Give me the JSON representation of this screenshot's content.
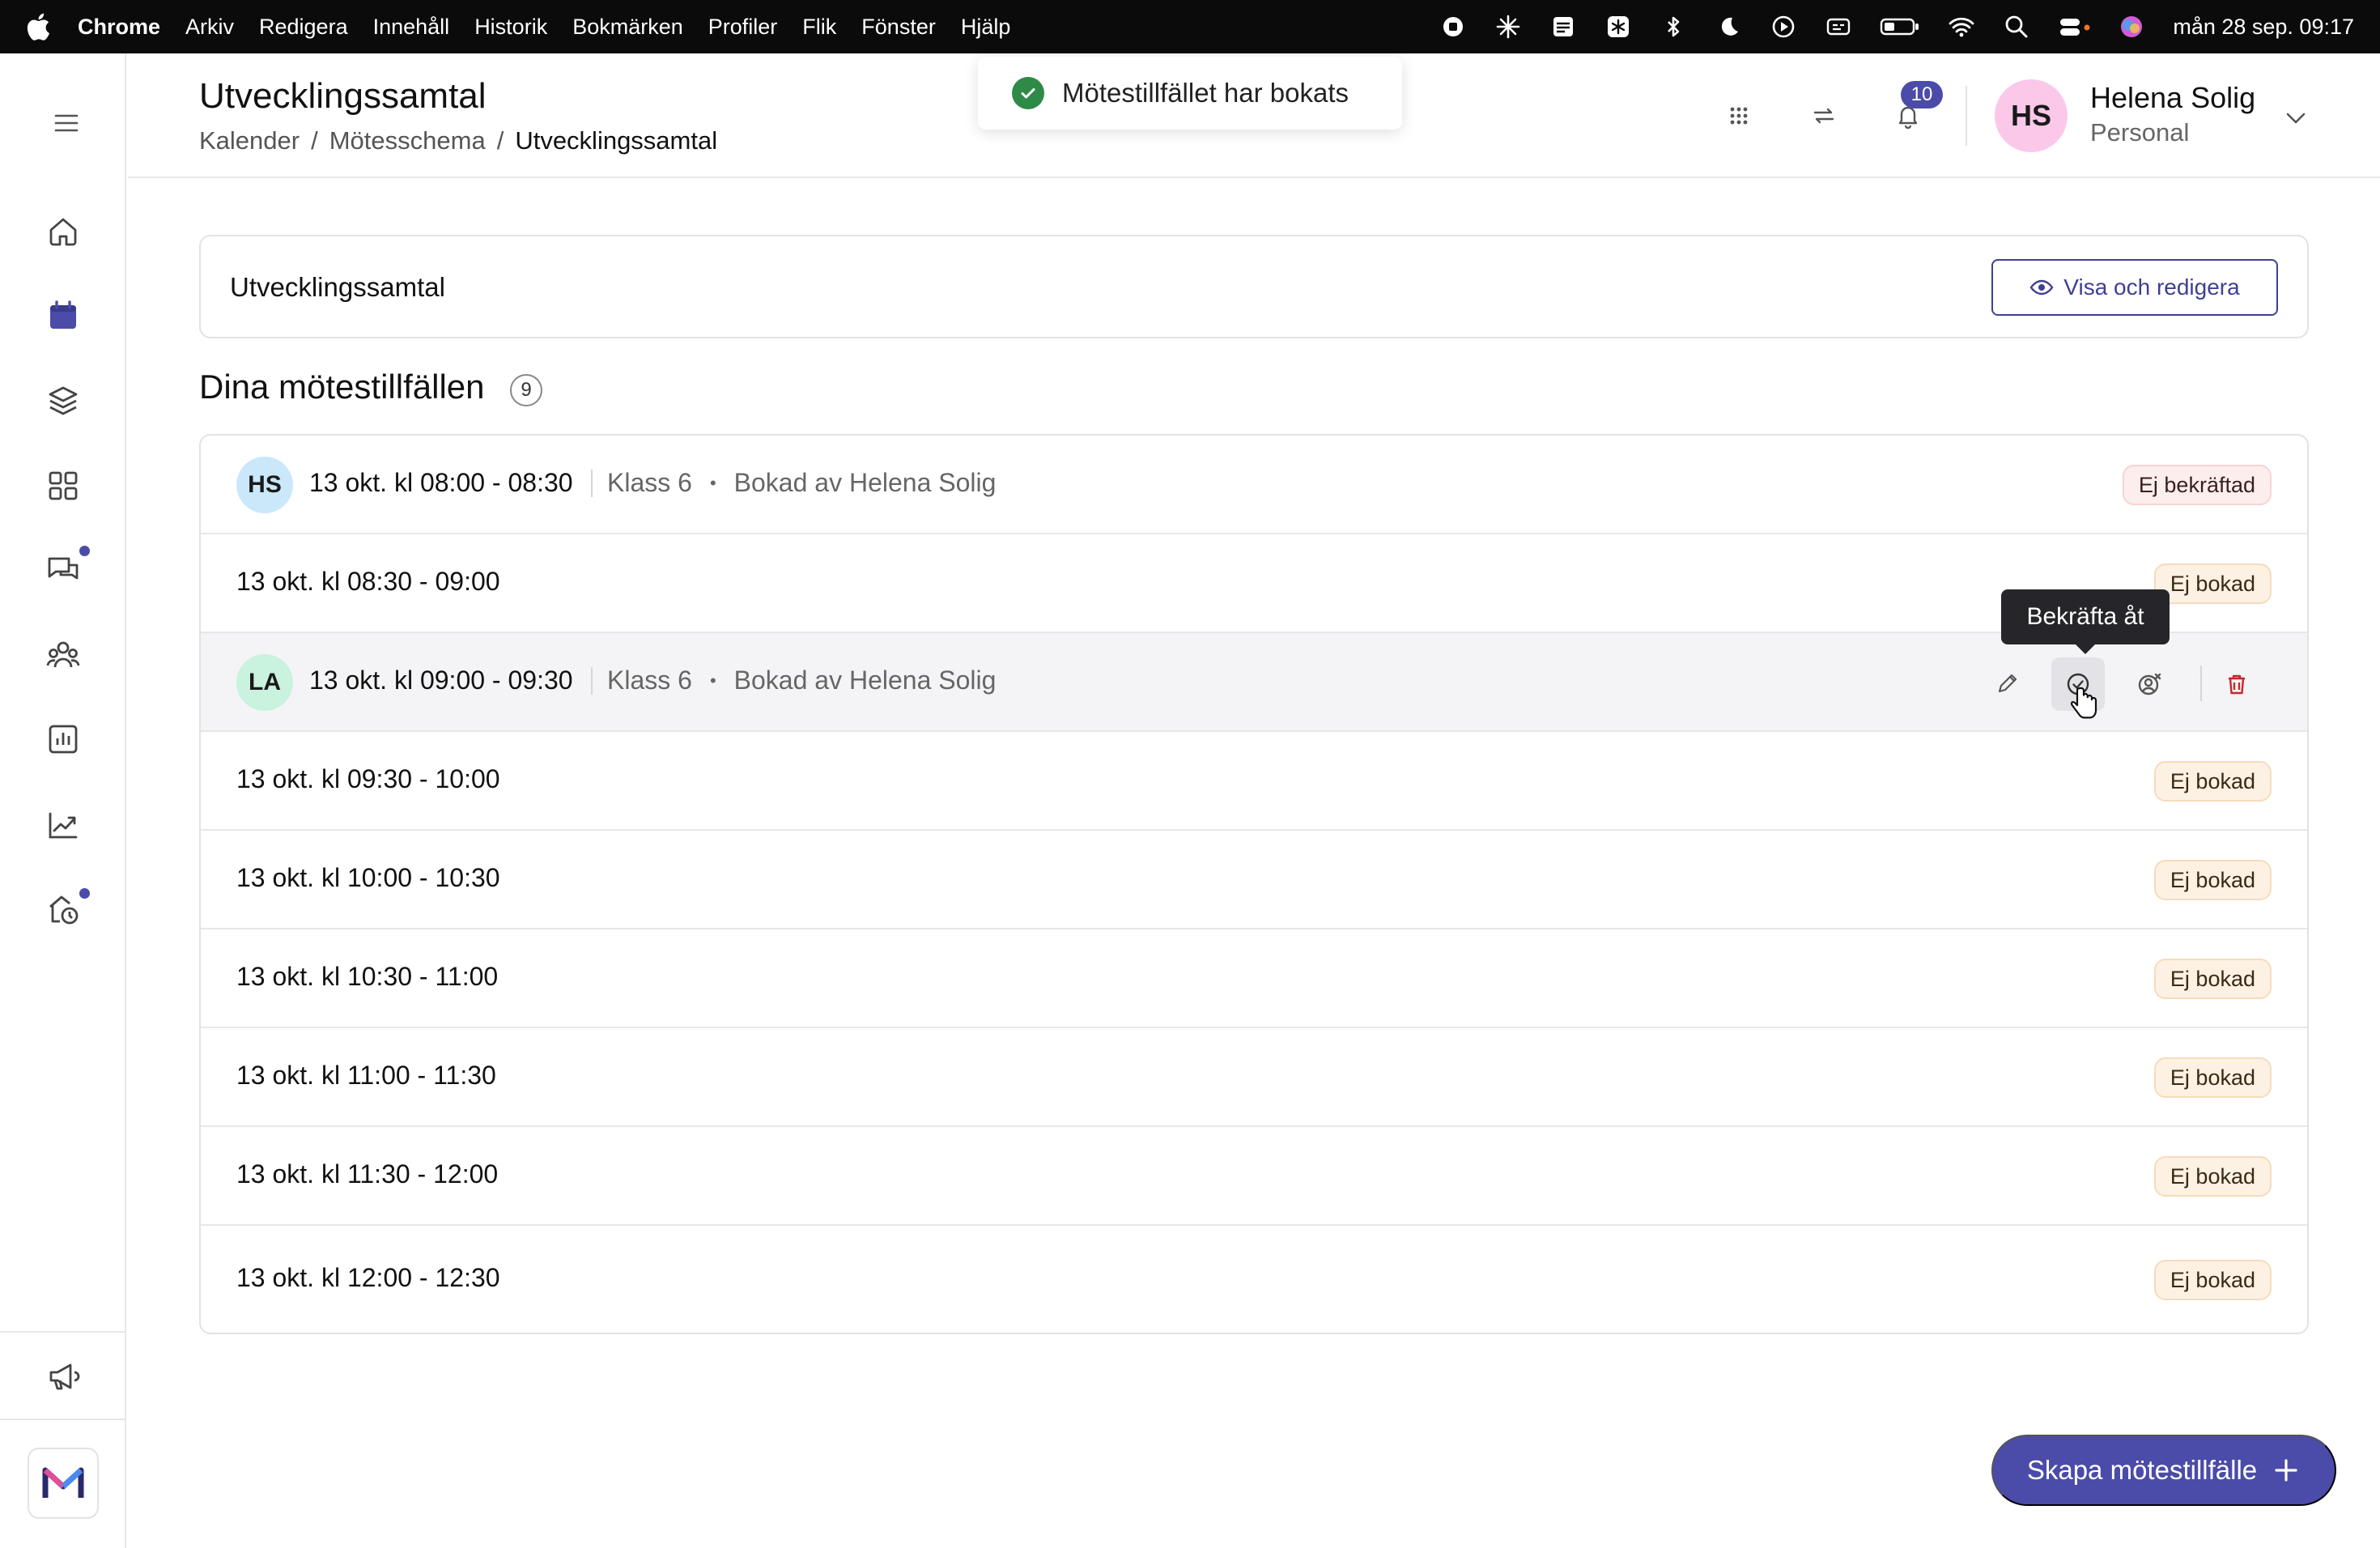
{
  "menubar": {
    "app_name": "Chrome",
    "menus": [
      "Arkiv",
      "Redigera",
      "Innehåll",
      "Historik",
      "Bokmärken",
      "Profiler",
      "Flik",
      "Fönster",
      "Hjälp"
    ],
    "clock": "mån 28 sep. 09:17"
  },
  "sidebar": {
    "items": [
      {
        "name": "home",
        "icon": "home-icon"
      },
      {
        "name": "calendar",
        "icon": "calendar-icon",
        "active": true
      },
      {
        "name": "layers",
        "icon": "layers-icon"
      },
      {
        "name": "apps",
        "icon": "grid-icon"
      },
      {
        "name": "messages",
        "icon": "chat-icon",
        "dot": true
      },
      {
        "name": "groups",
        "icon": "people-icon"
      },
      {
        "name": "reports",
        "icon": "bar-chart-icon"
      },
      {
        "name": "analytics",
        "icon": "trend-chart-icon"
      },
      {
        "name": "school",
        "icon": "house-clock-icon",
        "dot": true
      }
    ],
    "announcement_icon": "megaphone-icon",
    "logo": "m-logo"
  },
  "header": {
    "title": "Utvecklingssamtal",
    "breadcrumb": [
      "Kalender",
      "/",
      "Mötesschema",
      "/",
      "Utvecklingssamtal"
    ],
    "notifications_count": "10",
    "user": {
      "initials": "HS",
      "name": "Helena Solig",
      "role": "Personal"
    }
  },
  "toast": {
    "text": "Mötestillfället har bokats"
  },
  "meeting": {
    "title": "Utvecklingssamtal",
    "view_button": "Visa och redigera"
  },
  "section": {
    "title": "Dina mötestillfällen",
    "count": "9"
  },
  "slots": [
    {
      "initials": "HS",
      "time": "13 okt. kl 08:00 - 08:30",
      "class": "Klass 6",
      "booked_by": "Bokad av Helena Solig",
      "status": "Ej bekräftad"
    },
    {
      "time": "13 okt. kl 08:30 - 09:00",
      "status": "Ej bokad"
    },
    {
      "initials": "LA",
      "time": "13 okt. kl 09:00 - 09:30",
      "class": "Klass 6",
      "booked_by": "Bokad av Helena Solig"
    },
    {
      "time": "13 okt. kl 09:30 - 10:00",
      "status": "Ej bokad"
    },
    {
      "time": "13 okt. kl 10:00 - 10:30",
      "status": "Ej bokad"
    },
    {
      "time": "13 okt. kl 10:30 - 11:00",
      "status": "Ej bokad"
    },
    {
      "time": "13 okt. kl 11:00 - 11:30",
      "status": "Ej bokad"
    },
    {
      "time": "13 okt. kl 11:30 - 12:00",
      "status": "Ej bokad"
    },
    {
      "time": "13 okt. kl 12:00 - 12:30",
      "status": "Ej bokad"
    }
  ],
  "tooltip": {
    "text": "Bekräfta åt"
  },
  "create_button": {
    "label": "Skapa mötestillfälle"
  },
  "colors": {
    "accent": "#4b4ba9",
    "success": "#2f8a48",
    "danger": "#c62828"
  }
}
